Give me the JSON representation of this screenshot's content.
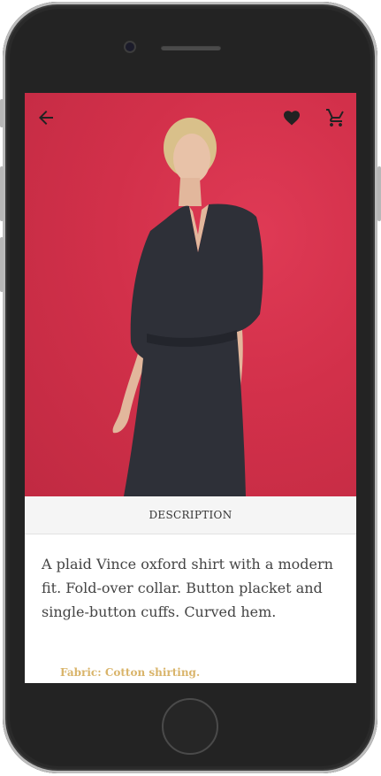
{
  "colors": {
    "hero_bg": "#d2304a",
    "dress": "#2e3038",
    "fabric_text": "#d9b46a",
    "header_bg": "#f5f5f5"
  },
  "toolbar": {
    "back_icon": "arrow-left-icon",
    "favorite_icon": "heart-icon",
    "cart_icon": "shopping-cart-icon"
  },
  "product": {
    "section_label": "DESCRIPTION",
    "description": "A plaid Vince oxford shirt with a modern fit. Fold-over collar. Button placket and single-button cuffs. Curved hem.",
    "fabric": "Fabric: Cotton shirting."
  }
}
